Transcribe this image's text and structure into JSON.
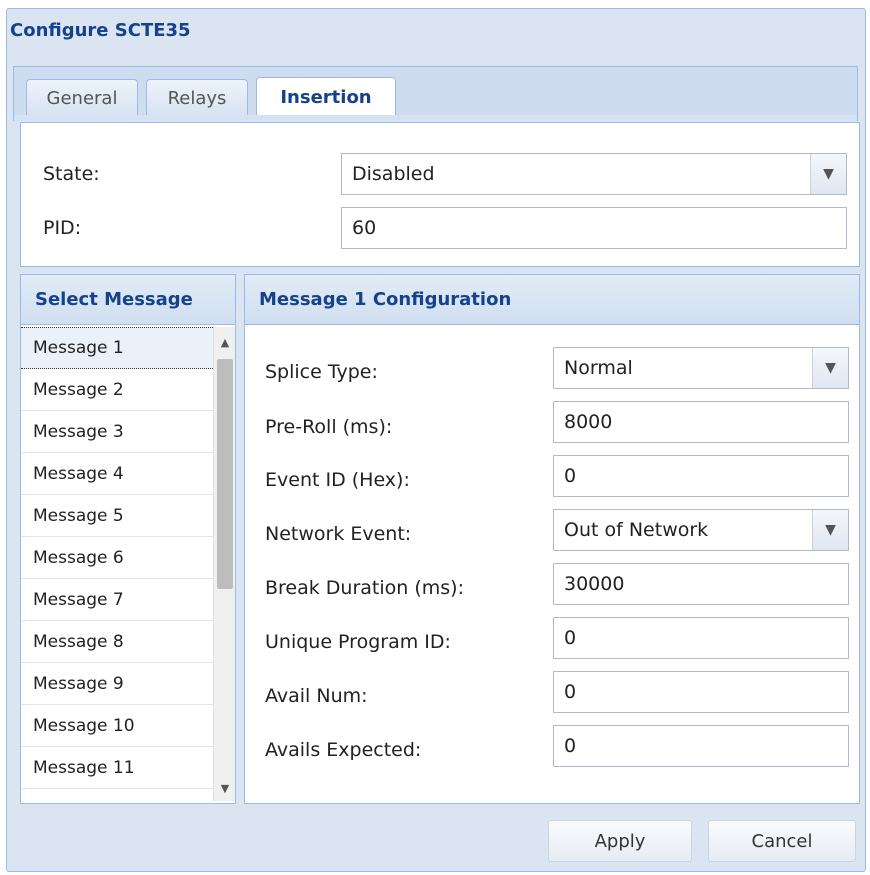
{
  "window": {
    "title": "Configure SCTE35"
  },
  "tabs": [
    {
      "label": "General"
    },
    {
      "label": "Relays"
    },
    {
      "label": "Insertion"
    }
  ],
  "general": {
    "state_label": "State:",
    "state_value": "Disabled",
    "pid_label": "PID:",
    "pid_value": "60"
  },
  "message_list": {
    "header": "Select Message",
    "items": [
      {
        "label": "Message 1"
      },
      {
        "label": "Message 2"
      },
      {
        "label": "Message 3"
      },
      {
        "label": "Message 4"
      },
      {
        "label": "Message 5"
      },
      {
        "label": "Message 6"
      },
      {
        "label": "Message 7"
      },
      {
        "label": "Message 8"
      },
      {
        "label": "Message 9"
      },
      {
        "label": "Message 10"
      },
      {
        "label": "Message 11"
      }
    ]
  },
  "config": {
    "header": "Message 1 Configuration",
    "fields": [
      {
        "label": "Splice Type:",
        "value": "Normal"
      },
      {
        "label": "Pre-Roll (ms):",
        "value": "8000"
      },
      {
        "label": "Event ID (Hex):",
        "value": "0"
      },
      {
        "label": "Network Event:",
        "value": "Out of Network"
      },
      {
        "label": "Break Duration (ms):",
        "value": "30000"
      },
      {
        "label": "Unique Program ID:",
        "value": "0"
      },
      {
        "label": "Avail Num:",
        "value": "0"
      },
      {
        "label": "Avails Expected:",
        "value": "0"
      }
    ]
  },
  "buttons": {
    "apply": "Apply",
    "cancel": "Cancel"
  },
  "icons": {
    "dropdown": "chevron-down-icon",
    "scroll_up": "scroll-up-arrow-icon",
    "scroll_down": "scroll-down-arrow-icon"
  }
}
